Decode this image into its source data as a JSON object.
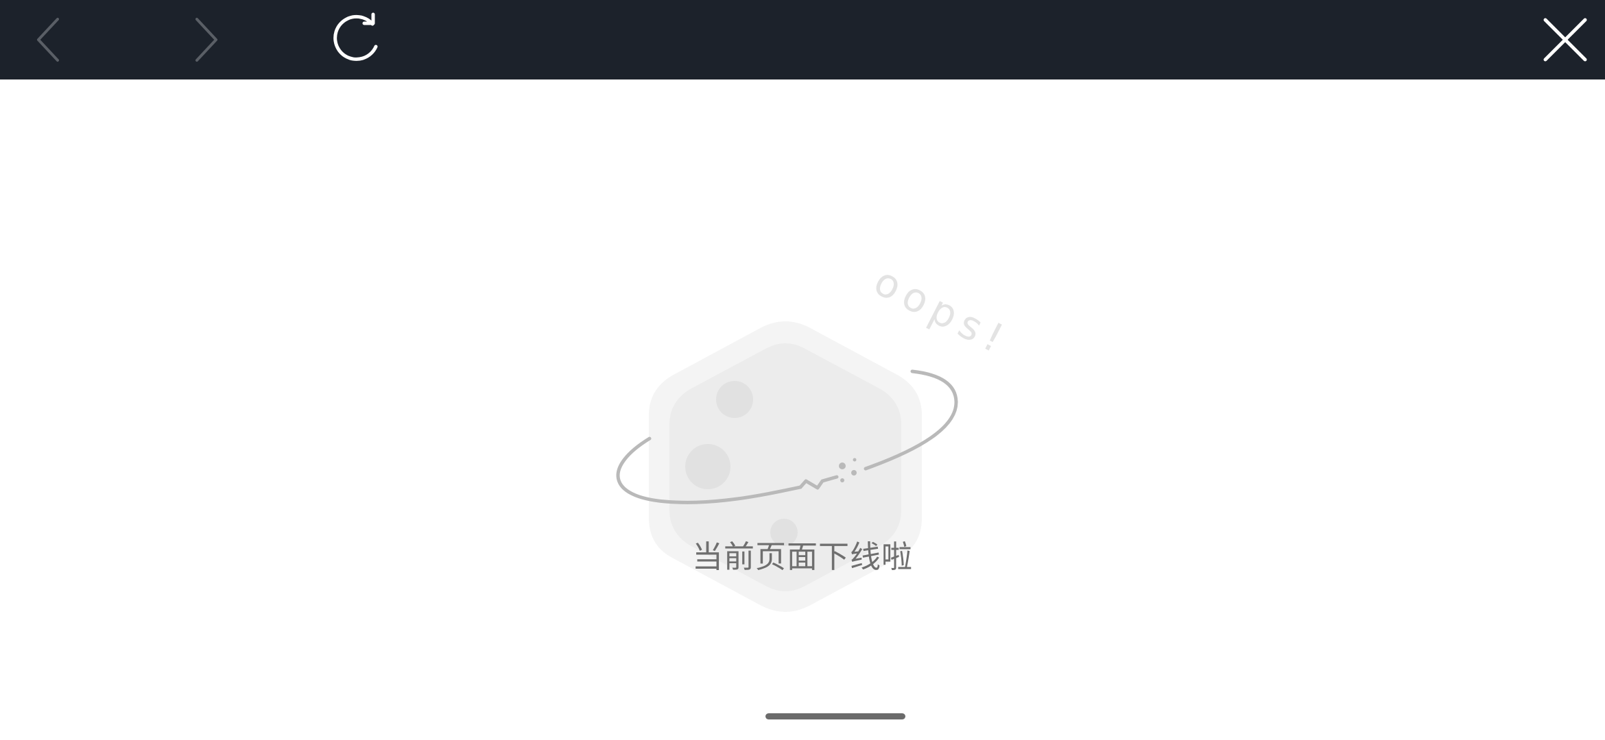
{
  "toolbar": {
    "icons": {
      "back": "chevron-left-icon",
      "forward": "chevron-right-icon",
      "refresh": "refresh-icon",
      "close": "close-icon"
    },
    "colors": {
      "background": "#1c222b",
      "disabled_icon": "#5a5f66",
      "active_icon": "#ffffff"
    }
  },
  "error_page": {
    "oops_text": "oops!",
    "message": "当前页面下线啦",
    "illustration": "planet-icon",
    "colors": {
      "planet_outer": "#f4f4f4",
      "planet_inner": "#ececec",
      "craters": "#e1e1e1",
      "ring": "#b9b9b9",
      "oops_text": "#e3e3e3",
      "message": "#6f6f6f"
    }
  },
  "system": {
    "home_indicator": "home-indicator"
  }
}
